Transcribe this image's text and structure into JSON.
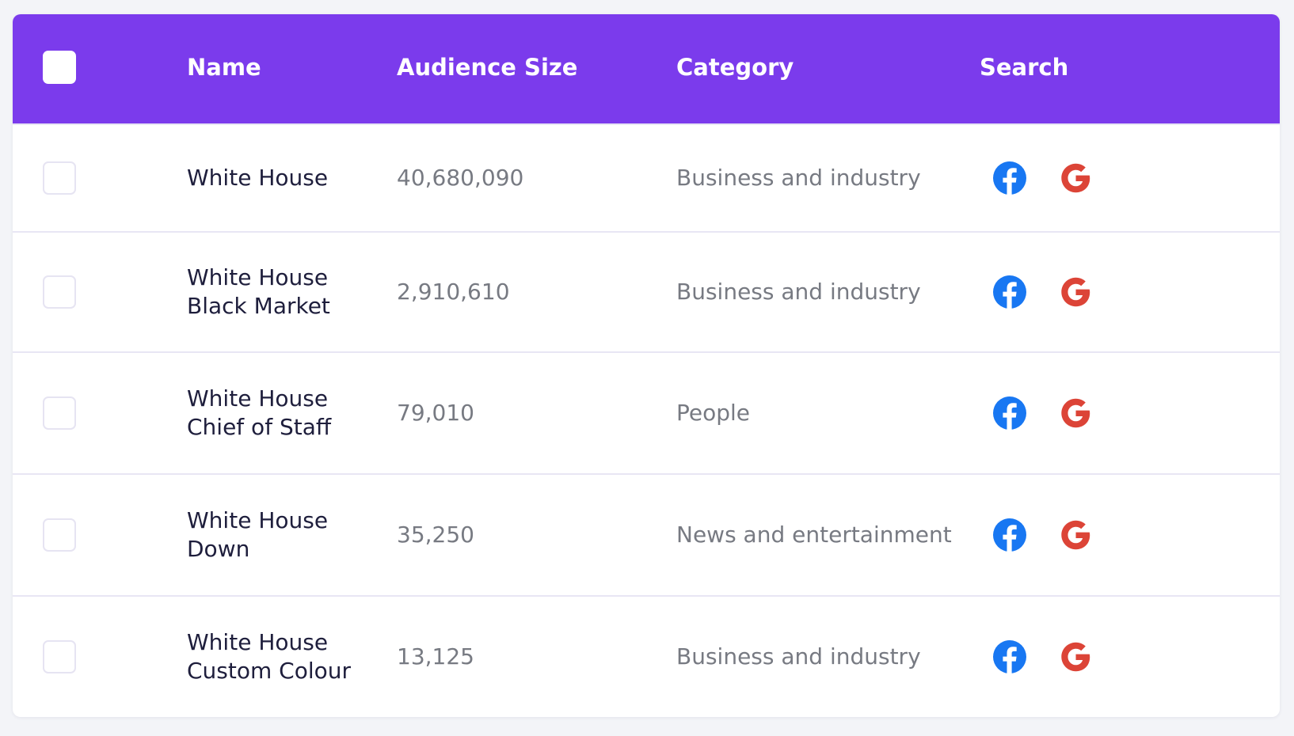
{
  "table": {
    "columns": [
      "Name",
      "Audience Size",
      "Category",
      "Search"
    ],
    "rows": [
      {
        "name_line1": "White House",
        "name_line2": "",
        "audience_size": "40,680,090",
        "category": "Business and industry",
        "search": [
          "facebook-icon",
          "google-icon"
        ]
      },
      {
        "name_line1": "White House",
        "name_line2": "Black Market",
        "audience_size": "2,910,610",
        "category": "Business and industry",
        "search": [
          "facebook-icon",
          "google-icon"
        ]
      },
      {
        "name_line1": "White House",
        "name_line2": "Chief of Staff",
        "audience_size": "79,010",
        "category": "People",
        "search": [
          "facebook-icon",
          "google-icon"
        ]
      },
      {
        "name_line1": "White House",
        "name_line2": "Down",
        "audience_size": "35,250",
        "category": "News and entertainment",
        "search": [
          "facebook-icon",
          "google-icon"
        ]
      },
      {
        "name_line1": "White House",
        "name_line2": "Custom Colour",
        "audience_size": "13,125",
        "category": "Business and industry",
        "search": [
          "facebook-icon",
          "google-icon"
        ]
      }
    ]
  },
  "colors": {
    "header_background": "#7b3bec",
    "facebook": "#1877f2",
    "google": "#dc4437"
  }
}
